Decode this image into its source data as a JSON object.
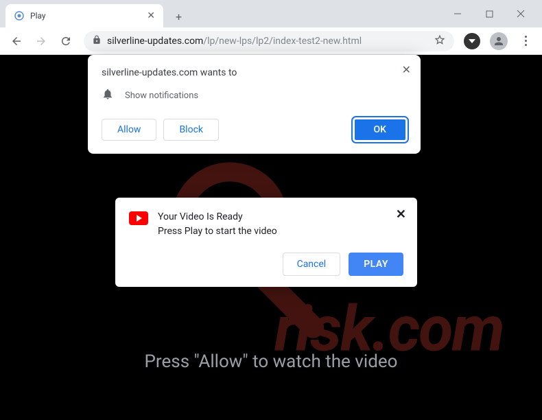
{
  "window": {
    "tab_title": "Play",
    "url_domain": "silverline-updates.com",
    "url_path": "/lp/new-lps/lp2/index-test2-new.html"
  },
  "permission": {
    "title": "silverline-updates.com wants to",
    "notification_label": "Show notifications",
    "allow_label": "Allow",
    "block_label": "Block",
    "ok_label": "OK"
  },
  "video_modal": {
    "line1": "Your Video Is Ready",
    "line2": "Press Play to start the video",
    "cancel_label": "Cancel",
    "play_label": "PLAY"
  },
  "page_prompt": "Press \"Allow\" to watch the video",
  "watermark_text": "risk.com"
}
